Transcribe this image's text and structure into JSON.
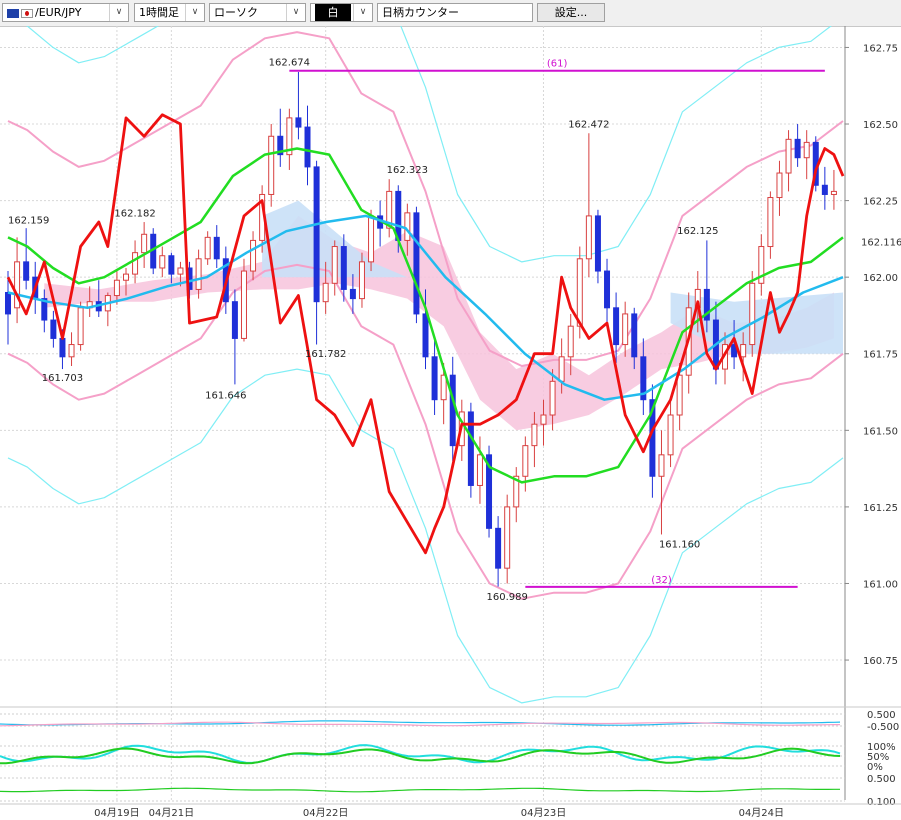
{
  "toolbar": {
    "symbol": "/EUR/JPY",
    "timeframe": "1時間足",
    "chart_style": "ローソク",
    "color_mode": "白",
    "counter_label": "日柄カウンター",
    "settings_label": "設定..."
  },
  "colors": {
    "bull": "#d84040",
    "bear": "#1f30d8",
    "ma_fast": "#ee1111",
    "bb_mid": "#22dd22",
    "bb1": "#f5a0c8",
    "bb2": "#80eef5",
    "ma_slow": "#22bbee",
    "cloud_pink": "#f7c3dc",
    "cloud_blue": "#c9e0f7",
    "marker": "#d010d0"
  },
  "chart_data": {
    "type": "candlestick",
    "symbol": "EUR/JPY",
    "timeframe": "1時間足",
    "ylim": [
      160.6,
      162.82
    ],
    "y_ticks": [
      162.75,
      162.5,
      162.25,
      162.0,
      161.75,
      161.5,
      161.25,
      161.0,
      160.75
    ],
    "y_tick_labels": [
      "162.75",
      "162.50",
      "162.25",
      "162.00",
      "161.75",
      "161.50",
      "161.25",
      "161.00",
      "160.75"
    ],
    "current_price_label": "162.116",
    "x_labels": [
      "04月19日",
      "04月21日",
      "04月22日",
      "04月23日",
      "04月24日"
    ],
    "x_label_index": [
      12,
      18,
      35,
      59,
      83
    ],
    "n_bars": 92,
    "ohlc": [
      [
        161.95,
        162.02,
        161.78,
        161.88
      ],
      [
        161.9,
        162.13,
        161.85,
        162.05
      ],
      [
        162.05,
        162.16,
        161.96,
        161.99
      ],
      [
        162.0,
        162.05,
        161.88,
        161.93
      ],
      [
        161.93,
        161.96,
        161.82,
        161.86
      ],
      [
        161.86,
        161.89,
        161.77,
        161.8
      ],
      [
        161.8,
        161.83,
        161.7,
        161.74
      ],
      [
        161.74,
        161.82,
        161.71,
        161.78
      ],
      [
        161.78,
        161.92,
        161.76,
        161.9
      ],
      [
        161.9,
        161.97,
        161.87,
        161.92
      ],
      [
        161.92,
        161.99,
        161.87,
        161.89
      ],
      [
        161.89,
        161.95,
        161.84,
        161.94
      ],
      [
        161.94,
        162.02,
        161.91,
        161.99
      ],
      [
        161.99,
        162.03,
        161.94,
        162.01
      ],
      [
        162.01,
        162.12,
        161.98,
        162.08
      ],
      [
        162.08,
        162.18,
        162.03,
        162.14
      ],
      [
        162.14,
        162.16,
        162.01,
        162.03
      ],
      [
        162.03,
        162.1,
        162.0,
        162.07
      ],
      [
        162.07,
        162.08,
        161.98,
        162.01
      ],
      [
        162.01,
        162.05,
        161.97,
        162.03
      ],
      [
        162.03,
        162.05,
        161.93,
        161.96
      ],
      [
        161.96,
        162.09,
        161.93,
        162.06
      ],
      [
        162.06,
        162.15,
        162.04,
        162.13
      ],
      [
        162.13,
        162.17,
        162.03,
        162.06
      ],
      [
        162.06,
        162.1,
        161.88,
        161.92
      ],
      [
        161.92,
        161.96,
        161.65,
        161.8
      ],
      [
        161.8,
        162.06,
        161.79,
        162.02
      ],
      [
        162.02,
        162.15,
        161.99,
        162.12
      ],
      [
        162.12,
        162.3,
        162.08,
        162.27
      ],
      [
        162.27,
        162.5,
        162.23,
        162.46
      ],
      [
        162.46,
        162.55,
        162.36,
        162.4
      ],
      [
        162.4,
        162.55,
        162.35,
        162.52
      ],
      [
        162.52,
        162.67,
        162.45,
        162.49
      ],
      [
        162.49,
        162.56,
        162.3,
        162.36
      ],
      [
        162.36,
        162.38,
        161.78,
        161.92
      ],
      [
        161.92,
        162.05,
        161.88,
        161.98
      ],
      [
        161.98,
        162.12,
        161.94,
        162.1
      ],
      [
        162.1,
        162.14,
        161.92,
        161.96
      ],
      [
        161.96,
        162.01,
        161.88,
        161.93
      ],
      [
        161.93,
        162.08,
        161.9,
        162.05
      ],
      [
        162.05,
        162.22,
        162.02,
        162.2
      ],
      [
        162.2,
        162.25,
        162.1,
        162.16
      ],
      [
        162.16,
        162.32,
        162.13,
        162.28
      ],
      [
        162.28,
        162.3,
        162.08,
        162.12
      ],
      [
        162.12,
        162.24,
        162.07,
        162.21
      ],
      [
        162.21,
        162.23,
        161.85,
        161.88
      ],
      [
        161.88,
        161.96,
        161.7,
        161.74
      ],
      [
        161.74,
        161.8,
        161.55,
        161.6
      ],
      [
        161.6,
        161.72,
        161.52,
        161.68
      ],
      [
        161.68,
        161.74,
        161.4,
        161.45
      ],
      [
        161.45,
        161.6,
        161.4,
        161.56
      ],
      [
        161.56,
        161.59,
        161.28,
        161.32
      ],
      [
        161.32,
        161.48,
        161.26,
        161.42
      ],
      [
        161.42,
        161.45,
        161.15,
        161.18
      ],
      [
        161.18,
        161.22,
        160.99,
        161.05
      ],
      [
        161.05,
        161.29,
        161.0,
        161.25
      ],
      [
        161.25,
        161.38,
        161.2,
        161.35
      ],
      [
        161.35,
        161.48,
        161.3,
        161.45
      ],
      [
        161.45,
        161.56,
        161.38,
        161.52
      ],
      [
        161.52,
        161.6,
        161.45,
        161.55
      ],
      [
        161.55,
        161.7,
        161.5,
        161.66
      ],
      [
        161.66,
        161.8,
        161.62,
        161.74
      ],
      [
        161.74,
        161.88,
        161.68,
        161.84
      ],
      [
        161.84,
        162.1,
        161.8,
        162.06
      ],
      [
        162.06,
        162.47,
        162.0,
        162.2
      ],
      [
        162.2,
        162.22,
        161.98,
        162.02
      ],
      [
        162.02,
        162.06,
        161.85,
        161.9
      ],
      [
        161.9,
        161.95,
        161.72,
        161.78
      ],
      [
        161.78,
        161.92,
        161.74,
        161.88
      ],
      [
        161.88,
        161.9,
        161.7,
        161.74
      ],
      [
        161.74,
        161.8,
        161.55,
        161.6
      ],
      [
        161.6,
        161.65,
        161.28,
        161.35
      ],
      [
        161.35,
        161.5,
        161.16,
        161.42
      ],
      [
        161.42,
        161.6,
        161.38,
        161.55
      ],
      [
        161.55,
        161.72,
        161.5,
        161.68
      ],
      [
        161.68,
        161.95,
        161.62,
        161.9
      ],
      [
        161.9,
        162.02,
        161.82,
        161.96
      ],
      [
        161.96,
        162.12,
        161.82,
        161.86
      ],
      [
        161.86,
        161.92,
        161.65,
        161.7
      ],
      [
        161.7,
        161.82,
        161.65,
        161.78
      ],
      [
        161.78,
        161.86,
        161.7,
        161.74
      ],
      [
        161.74,
        161.82,
        161.66,
        161.78
      ],
      [
        161.78,
        162.02,
        161.74,
        161.98
      ],
      [
        161.98,
        162.14,
        161.94,
        162.1
      ],
      [
        162.1,
        162.28,
        162.06,
        162.26
      ],
      [
        162.26,
        162.38,
        162.2,
        162.34
      ],
      [
        162.34,
        162.48,
        162.28,
        162.45
      ],
      [
        162.45,
        162.5,
        162.36,
        162.39
      ],
      [
        162.39,
        162.48,
        162.32,
        162.44
      ],
      [
        162.44,
        162.46,
        162.28,
        162.3
      ],
      [
        162.3,
        162.36,
        162.22,
        162.27
      ],
      [
        162.27,
        162.35,
        162.22,
        162.28
      ]
    ],
    "lines": [
      {
        "name": "ma_fast",
        "points": [
          [
            0,
            162.0
          ],
          [
            2,
            161.88
          ],
          [
            4,
            162.05
          ],
          [
            6,
            161.8
          ],
          [
            8,
            162.1
          ],
          [
            10,
            162.18
          ],
          [
            11,
            162.1
          ],
          [
            13,
            162.52
          ],
          [
            15,
            162.46
          ],
          [
            17,
            162.53
          ],
          [
            19,
            162.5
          ],
          [
            20,
            161.85
          ],
          [
            23,
            161.87
          ],
          [
            26,
            162.2
          ],
          [
            28,
            162.25
          ],
          [
            30,
            161.85
          ],
          [
            32,
            161.94
          ],
          [
            34,
            161.6
          ],
          [
            36,
            161.55
          ],
          [
            38,
            161.45
          ],
          [
            40,
            161.6
          ],
          [
            42,
            161.3
          ],
          [
            44,
            161.2
          ],
          [
            46,
            161.1
          ],
          [
            47,
            161.18
          ],
          [
            48,
            161.25
          ],
          [
            50,
            161.52
          ],
          [
            52,
            161.52
          ],
          [
            54,
            161.55
          ],
          [
            56,
            161.6
          ],
          [
            58,
            161.75
          ],
          [
            60,
            161.75
          ],
          [
            61,
            162.0
          ],
          [
            62,
            161.9
          ],
          [
            64,
            161.8
          ],
          [
            66,
            161.85
          ],
          [
            67,
            161.7
          ],
          [
            68,
            161.55
          ],
          [
            70,
            161.43
          ],
          [
            71,
            161.5
          ],
          [
            73,
            161.6
          ],
          [
            75,
            161.8
          ],
          [
            76,
            161.92
          ],
          [
            77,
            161.75
          ],
          [
            78,
            161.7
          ],
          [
            80,
            161.8
          ],
          [
            82,
            161.62
          ],
          [
            84,
            161.95
          ],
          [
            85,
            161.82
          ],
          [
            86,
            161.88
          ],
          [
            87,
            161.95
          ],
          [
            88,
            162.2
          ],
          [
            89,
            162.35
          ],
          [
            90,
            162.42
          ],
          [
            91,
            162.4
          ],
          [
            92,
            162.33
          ]
        ]
      },
      {
        "name": "bb_mid",
        "points": [
          [
            0,
            162.13
          ],
          [
            3,
            162.1
          ],
          [
            7,
            162.03
          ],
          [
            11,
            161.98
          ],
          [
            15,
            162.0
          ],
          [
            20,
            162.06
          ],
          [
            25,
            162.12
          ],
          [
            30,
            162.18
          ],
          [
            35,
            162.33
          ],
          [
            40,
            162.4
          ],
          [
            45,
            162.42
          ],
          [
            50,
            162.4
          ],
          [
            55,
            162.22
          ],
          [
            60,
            162.16
          ],
          [
            65,
            161.9
          ],
          [
            70,
            161.55
          ],
          [
            75,
            161.38
          ],
          [
            80,
            161.33
          ],
          [
            85,
            161.35
          ],
          [
            90,
            161.35
          ],
          [
            95,
            161.38
          ],
          [
            100,
            161.55
          ],
          [
            105,
            161.82
          ],
          [
            110,
            161.9
          ],
          [
            115,
            161.98
          ],
          [
            120,
            162.03
          ],
          [
            125,
            162.05
          ],
          [
            130,
            162.13
          ]
        ]
      },
      {
        "name": "ma_slow",
        "points": [
          [
            0,
            161.95
          ],
          [
            5,
            161.92
          ],
          [
            10,
            161.9
          ],
          [
            15,
            161.93
          ],
          [
            20,
            161.97
          ],
          [
            25,
            162.0
          ],
          [
            30,
            162.08
          ],
          [
            35,
            162.15
          ],
          [
            40,
            162.18
          ],
          [
            45,
            162.2
          ],
          [
            50,
            162.16
          ],
          [
            55,
            162.0
          ],
          [
            60,
            161.88
          ],
          [
            65,
            161.75
          ],
          [
            70,
            161.65
          ],
          [
            75,
            161.6
          ],
          [
            80,
            161.62
          ],
          [
            85,
            161.7
          ],
          [
            90,
            161.8
          ],
          [
            95,
            161.87
          ],
          [
            100,
            161.95
          ],
          [
            105,
            162.0
          ]
        ]
      }
    ],
    "annotations": [
      {
        "label": "162.674",
        "x": 31,
        "y": 162.674
      },
      {
        "label": "162.472",
        "x": 64,
        "y": 162.472
      },
      {
        "label": "162.323",
        "x": 44,
        "y": 162.323
      },
      {
        "label": "162.182",
        "x": 14,
        "y": 162.182
      },
      {
        "label": "162.159",
        "x": 0,
        "y": 162.159
      },
      {
        "label": "162.125",
        "x": 76,
        "y": 162.125
      },
      {
        "label": "161.782",
        "x": 35,
        "y": 161.782
      },
      {
        "label": "161.703",
        "x": 6,
        "y": 161.703
      },
      {
        "label": "161.646",
        "x": 24,
        "y": 161.646
      },
      {
        "label": "161.160",
        "x": 74,
        "y": 161.16
      },
      {
        "label": "160.989",
        "x": 55,
        "y": 160.989
      }
    ],
    "level_markers": [
      {
        "label": "(61)",
        "y": 162.674,
        "x_start": 31,
        "x_end": 90
      },
      {
        "label": "(32)",
        "y": 160.989,
        "x_start": 57,
        "x_end": 87
      }
    ],
    "oscillator_labels": [
      "0.500",
      "-0.500",
      "100%",
      "50%",
      "0%",
      "0.500",
      "0.100"
    ]
  }
}
